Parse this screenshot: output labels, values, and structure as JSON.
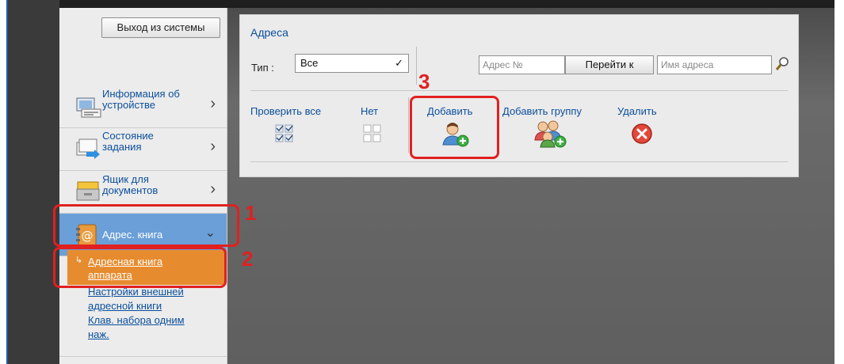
{
  "sidebar": {
    "logout_label": "Выход из системы",
    "items": [
      {
        "label_line1": "Информация об",
        "label_line2": "устройстве",
        "icon": "device-info-icon"
      },
      {
        "label_line1": "Состояние",
        "label_line2": "задания",
        "icon": "job-status-icon"
      },
      {
        "label_line1": "Ящик для",
        "label_line2": "документов",
        "icon": "document-box-icon"
      },
      {
        "label": "Адрес. книга",
        "icon": "address-book-icon"
      }
    ],
    "sub_items": [
      {
        "label_line1": "Адресная книга",
        "label_line2": "аппарата"
      }
    ],
    "links": [
      {
        "label_line1": "Настройки внешней",
        "label_line2": "адресной книги"
      },
      {
        "label_line1": "Клав. набора одним",
        "label_line2": "наж."
      }
    ]
  },
  "panel": {
    "title": "Адреса",
    "type_label": "Тип :",
    "type_value": "Все",
    "address_no_placeholder": "Адрес №",
    "goto_label": "Перейти к",
    "address_name_placeholder": "Имя адреса",
    "check_all_label": "Проверить все",
    "none_label": "Нет",
    "add_label": "Добавить",
    "add_group_label": "Добавить группу",
    "delete_label": "Удалить"
  },
  "annotations": {
    "step1": "1",
    "step2": "2",
    "step3": "3",
    "highlight_color": "#e12020"
  }
}
